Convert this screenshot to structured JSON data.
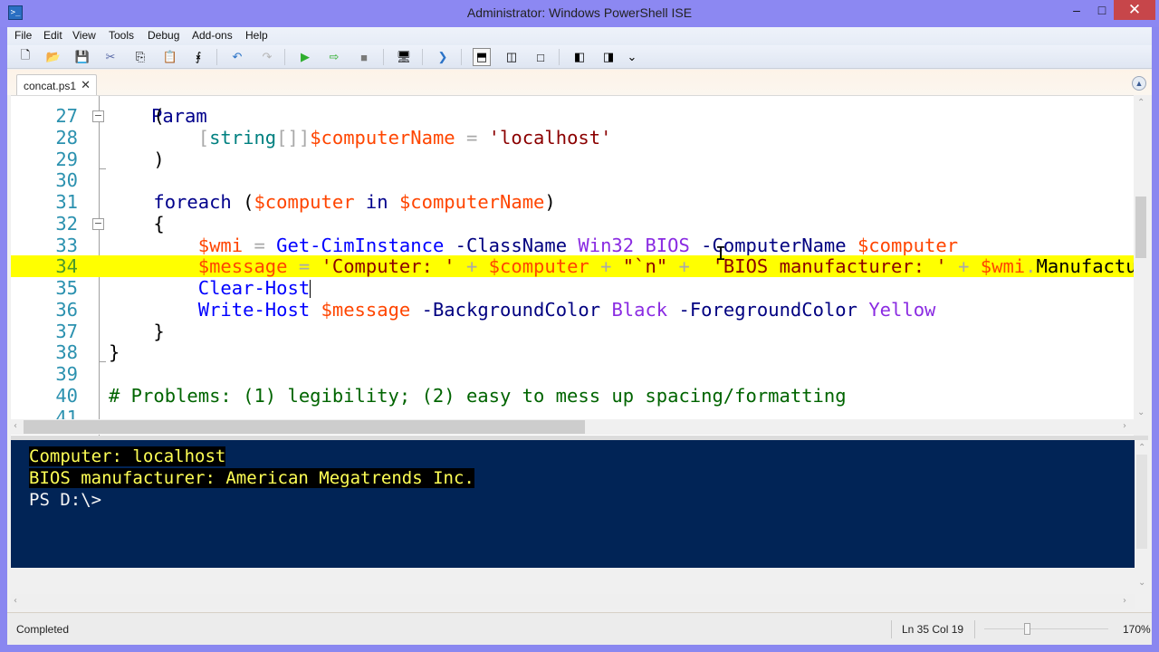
{
  "window": {
    "title": "Administrator: Windows PowerShell ISE",
    "controls": {
      "minimize": "–",
      "maximize": "□",
      "close": "✕"
    }
  },
  "menu": [
    {
      "label": "File"
    },
    {
      "label": "Edit"
    },
    {
      "label": "View"
    },
    {
      "label": "Tools"
    },
    {
      "label": "Debug"
    },
    {
      "label": "Add-ons"
    },
    {
      "label": "Help"
    }
  ],
  "toolbar": [
    {
      "name": "new-icon",
      "glyph": "🗋"
    },
    {
      "name": "open-icon",
      "glyph": "📂"
    },
    {
      "name": "save-icon",
      "glyph": "💾"
    },
    {
      "name": "cut-icon",
      "glyph": "✂"
    },
    {
      "name": "copy-icon",
      "glyph": "⎘"
    },
    {
      "name": "paste-icon",
      "glyph": "📋"
    },
    {
      "name": "clear-console-icon",
      "glyph": "⨘"
    },
    {
      "name": "undo-icon",
      "glyph": "↶"
    },
    {
      "name": "redo-icon",
      "glyph": "↷"
    },
    {
      "name": "run-script-icon",
      "glyph": "▶"
    },
    {
      "name": "run-selection-icon",
      "glyph": "⇨"
    },
    {
      "name": "stop-icon",
      "glyph": "■"
    },
    {
      "name": "remote-tab-icon",
      "glyph": "🖥"
    },
    {
      "name": "start-powershell-icon",
      "glyph": "❯"
    },
    {
      "name": "script-pane-top-icon",
      "glyph": "⬒"
    },
    {
      "name": "script-pane-right-icon",
      "glyph": "◫"
    },
    {
      "name": "script-pane-maximized-icon",
      "glyph": "□"
    },
    {
      "name": "show-script-pane-icon",
      "glyph": "◧"
    },
    {
      "name": "show-command-addon-icon",
      "glyph": "◨"
    },
    {
      "name": "toolbar-overflow-icon",
      "glyph": "⌄"
    }
  ],
  "tabs": [
    {
      "label": "concat.ps1",
      "close": "✕",
      "active": true
    }
  ],
  "editor": {
    "partial_top_line": "Param",
    "lines": [
      {
        "n": "27",
        "tokens": [
          {
            "t": "    ",
            "c": ""
          },
          {
            "t": "(",
            "c": "t-grp"
          }
        ]
      },
      {
        "n": "28",
        "tokens": [
          {
            "t": "        ",
            "c": ""
          },
          {
            "t": "[",
            "c": "t-op"
          },
          {
            "t": "string",
            "c": "t-type"
          },
          {
            "t": "[]]",
            "c": "t-op"
          },
          {
            "t": "$computerName",
            "c": "t-var"
          },
          {
            "t": " ",
            "c": ""
          },
          {
            "t": "=",
            "c": "t-op"
          },
          {
            "t": " ",
            "c": ""
          },
          {
            "t": "'localhost'",
            "c": "t-str"
          }
        ]
      },
      {
        "n": "29",
        "tokens": [
          {
            "t": "    ",
            "c": ""
          },
          {
            "t": ")",
            "c": "t-grp"
          }
        ]
      },
      {
        "n": "30",
        "tokens": []
      },
      {
        "n": "31",
        "tokens": [
          {
            "t": "    ",
            "c": ""
          },
          {
            "t": "foreach",
            "c": "t-kw"
          },
          {
            "t": " (",
            "c": "t-grp"
          },
          {
            "t": "$computer",
            "c": "t-var"
          },
          {
            "t": " in ",
            "c": "t-kw"
          },
          {
            "t": "$computerName",
            "c": "t-var"
          },
          {
            "t": ")",
            "c": "t-grp"
          }
        ]
      },
      {
        "n": "32",
        "tokens": [
          {
            "t": "    ",
            "c": ""
          },
          {
            "t": "{",
            "c": "t-grp"
          }
        ]
      },
      {
        "n": "33",
        "tokens": [
          {
            "t": "        ",
            "c": ""
          },
          {
            "t": "$wmi",
            "c": "t-var"
          },
          {
            "t": " = ",
            "c": "t-op"
          },
          {
            "t": "Get-CimInstance",
            "c": "t-cmd"
          },
          {
            "t": " -ClassName ",
            "c": "t-param"
          },
          {
            "t": "Win32_BIOS",
            "c": "t-arg"
          },
          {
            "t": " -ComputerName ",
            "c": "t-param"
          },
          {
            "t": "$computer",
            "c": "t-var"
          }
        ]
      },
      {
        "n": "34",
        "highlight": true,
        "tokens": [
          {
            "t": "        ",
            "c": ""
          },
          {
            "t": "$message",
            "c": "t-var"
          },
          {
            "t": " = ",
            "c": "t-op"
          },
          {
            "t": "'Computer: '",
            "c": "t-str"
          },
          {
            "t": " + ",
            "c": "t-op"
          },
          {
            "t": "$computer",
            "c": "t-var"
          },
          {
            "t": " + ",
            "c": "t-op"
          },
          {
            "t": "\"`n\"",
            "c": "t-str"
          },
          {
            "t": " +  ",
            "c": "t-op"
          },
          {
            "t": "'BIOS manufacturer: '",
            "c": "t-str"
          },
          {
            "t": " + ",
            "c": "t-op"
          },
          {
            "t": "$wmi",
            "c": "t-var"
          },
          {
            "t": ".",
            "c": "t-op"
          },
          {
            "t": "Manufacturer",
            "c": "t-mem"
          }
        ]
      },
      {
        "n": "35",
        "caret": true,
        "tokens": [
          {
            "t": "        ",
            "c": ""
          },
          {
            "t": "Clear-Host",
            "c": "t-cmd"
          }
        ]
      },
      {
        "n": "36",
        "tokens": [
          {
            "t": "        ",
            "c": ""
          },
          {
            "t": "Write-Host",
            "c": "t-cmd"
          },
          {
            "t": " ",
            "c": ""
          },
          {
            "t": "$message",
            "c": "t-var"
          },
          {
            "t": " -BackgroundColor ",
            "c": "t-param"
          },
          {
            "t": "Black",
            "c": "t-arg"
          },
          {
            "t": " -ForegroundColor ",
            "c": "t-param"
          },
          {
            "t": "Yellow",
            "c": "t-arg"
          }
        ]
      },
      {
        "n": "37",
        "tokens": [
          {
            "t": "    ",
            "c": ""
          },
          {
            "t": "}",
            "c": "t-grp"
          }
        ]
      },
      {
        "n": "38",
        "tokens": [
          {
            "t": "}",
            "c": "t-grp"
          }
        ]
      },
      {
        "n": "39",
        "tokens": []
      },
      {
        "n": "40",
        "tokens": [
          {
            "t": "# Problems: (1) legibility; (2) easy to mess up spacing/formatting",
            "c": "t-com"
          }
        ]
      },
      {
        "n": "41",
        "tokens": []
      }
    ],
    "fold_lines": [
      "27",
      "32"
    ],
    "fold_end_lines": [
      "29",
      "38"
    ]
  },
  "console": {
    "output": [
      "Computer: localhost",
      "BIOS manufacturer: American Megatrends Inc."
    ],
    "prompt": "PS D:\\>"
  },
  "status": {
    "text": "Completed",
    "position": "Ln 35  Col 19",
    "zoom": "170%",
    "zoom_fraction": 0.35
  },
  "colors": {
    "titlebar": "#8c88f2",
    "console_bg": "#012456",
    "console_output_fg": "#ffff55",
    "highlight_line": "#ffff00",
    "line_numbers": "#2b91af"
  }
}
